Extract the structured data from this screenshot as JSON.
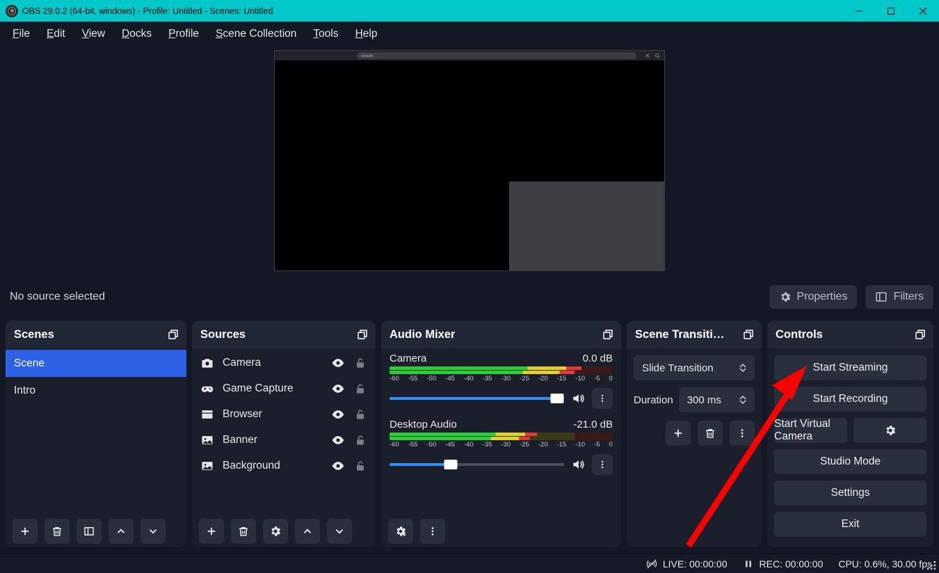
{
  "titlebar": {
    "title": "OBS 29.0.2 (64-bit, windows) - Profile: Untitled - Scenes: Untitled"
  },
  "menu": [
    "File",
    "Edit",
    "View",
    "Docks",
    "Profile",
    "Scene Collection",
    "Tools",
    "Help"
  ],
  "toolbar": {
    "no_source": "No source selected",
    "properties": "Properties",
    "filters": "Filters"
  },
  "preview": {
    "address_text": "ocean"
  },
  "scenes": {
    "title": "Scenes",
    "items": [
      {
        "label": "Scene",
        "active": true
      },
      {
        "label": "Intro",
        "active": false
      }
    ]
  },
  "sources": {
    "title": "Sources",
    "items": [
      {
        "icon": "camera",
        "label": "Camera"
      },
      {
        "icon": "gamepad",
        "label": "Game Capture"
      },
      {
        "icon": "window",
        "label": "Browser"
      },
      {
        "icon": "image",
        "label": "Banner"
      },
      {
        "icon": "image",
        "label": "Background"
      }
    ]
  },
  "mixer": {
    "title": "Audio Mixer",
    "channels": [
      {
        "name": "Camera",
        "level": "0.0 dB",
        "slider": 96,
        "meter": 86
      },
      {
        "name": "Desktop Audio",
        "level": "-21.0 dB",
        "slider": 35,
        "meter": 66
      }
    ],
    "scale": [
      "-60",
      "-55",
      "-50",
      "-45",
      "-40",
      "-35",
      "-30",
      "-25",
      "-20",
      "-15",
      "-10",
      "-5",
      "0"
    ]
  },
  "transitions": {
    "title": "Scene Transiti…",
    "selected": "Slide Transition",
    "duration_label": "Duration",
    "duration_value": "300 ms"
  },
  "controls": {
    "title": "Controls",
    "buttons": {
      "stream": "Start Streaming",
      "record": "Start Recording",
      "vcam": "Start Virtual Camera",
      "studio": "Studio Mode",
      "settings": "Settings",
      "exit": "Exit"
    }
  },
  "status": {
    "live": "LIVE: 00:00:00",
    "rec": "REC: 00:00:00",
    "cpu": "CPU: 0.6%, 30.00 fps"
  }
}
